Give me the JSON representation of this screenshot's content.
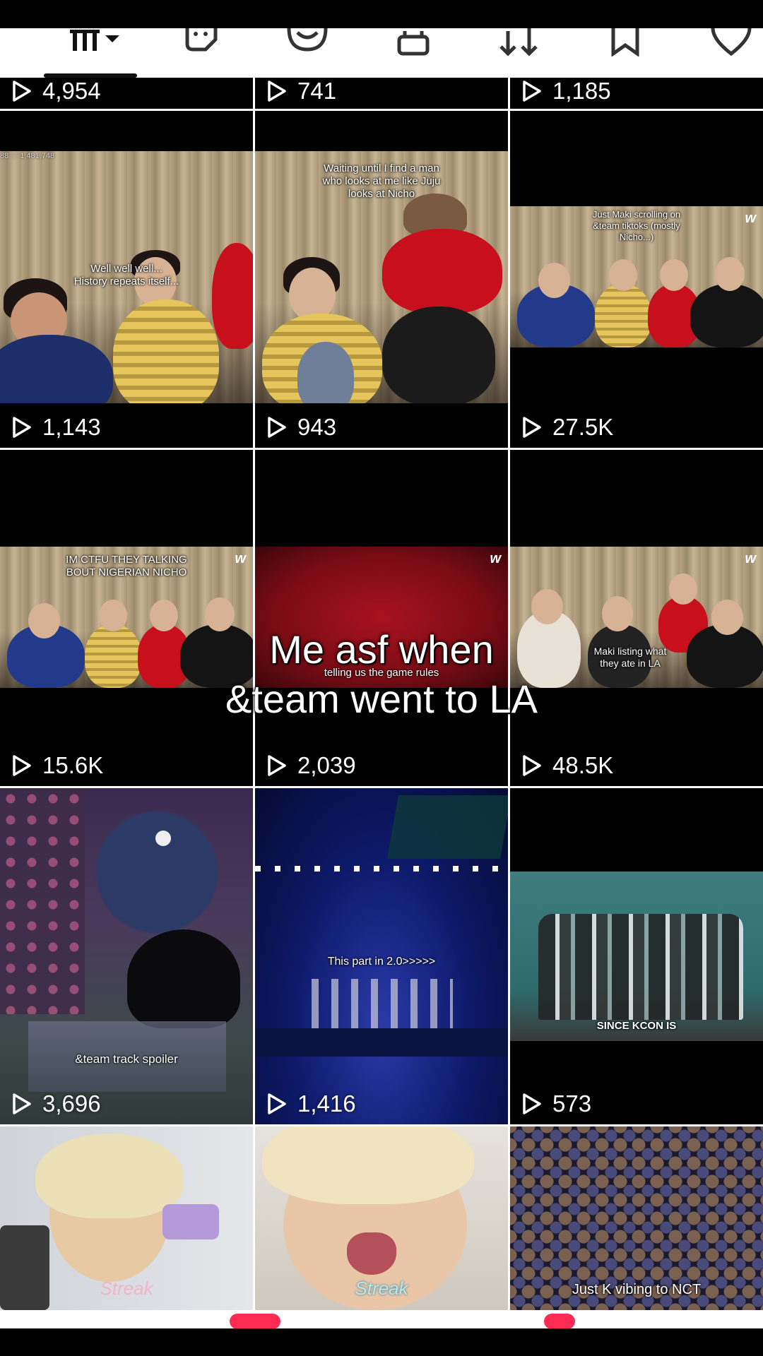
{
  "overlay": {
    "line1": "Me asf when",
    "line2": "&team went to LA"
  },
  "profile_tabs": [
    {
      "name": "videos-grid-icon"
    },
    {
      "name": "repost-sticker-icon"
    },
    {
      "name": "smile-icon"
    },
    {
      "name": "lock-icon"
    },
    {
      "name": "repost-icon"
    },
    {
      "name": "bookmark-icon"
    },
    {
      "name": "heart-icon"
    }
  ],
  "videos": [
    {
      "views": "4,954"
    },
    {
      "views": "741"
    },
    {
      "views": "1,185"
    },
    {
      "views": "1,143",
      "caption": "Well well well...\nHistory repeats itself...",
      "corner": "88 ♡ 1,481,748"
    },
    {
      "views": "943",
      "caption": "Waiting until I find a man\nwho looks at me like Juju\nlooks at Nicho"
    },
    {
      "views": "27.5K",
      "caption": "Just Maki scrolling on\n&team tiktoks (mostly\nNicho...)",
      "logo": "w"
    },
    {
      "views": "15.6K",
      "caption": "IM CTFU THEY TALKING\nBOUT NIGERIAN NICHO",
      "logo": "w"
    },
    {
      "views": "2,039",
      "caption": "telling us the game rules",
      "logo": "w"
    },
    {
      "views": "48.5K",
      "caption": "Maki listing what\nthey ate in LA",
      "logo": "w"
    },
    {
      "views": "3,696",
      "caption": "&team track spoiler"
    },
    {
      "views": "1,416",
      "caption": "This part in 2.0>>>>>"
    },
    {
      "views": "573",
      "caption": "SINCE KCON IS"
    },
    {
      "caption": "Streak"
    },
    {
      "caption": "Streak"
    },
    {
      "caption": "Just K vibing to NCT"
    }
  ],
  "colors": {
    "accent": "#fe2c55",
    "tab_bg": "#ffffff",
    "curtain": "#b8a585",
    "red_bg": "#8b0d17",
    "stage_bg": "#0a1550",
    "teal_bg": "#2e6b6b"
  }
}
